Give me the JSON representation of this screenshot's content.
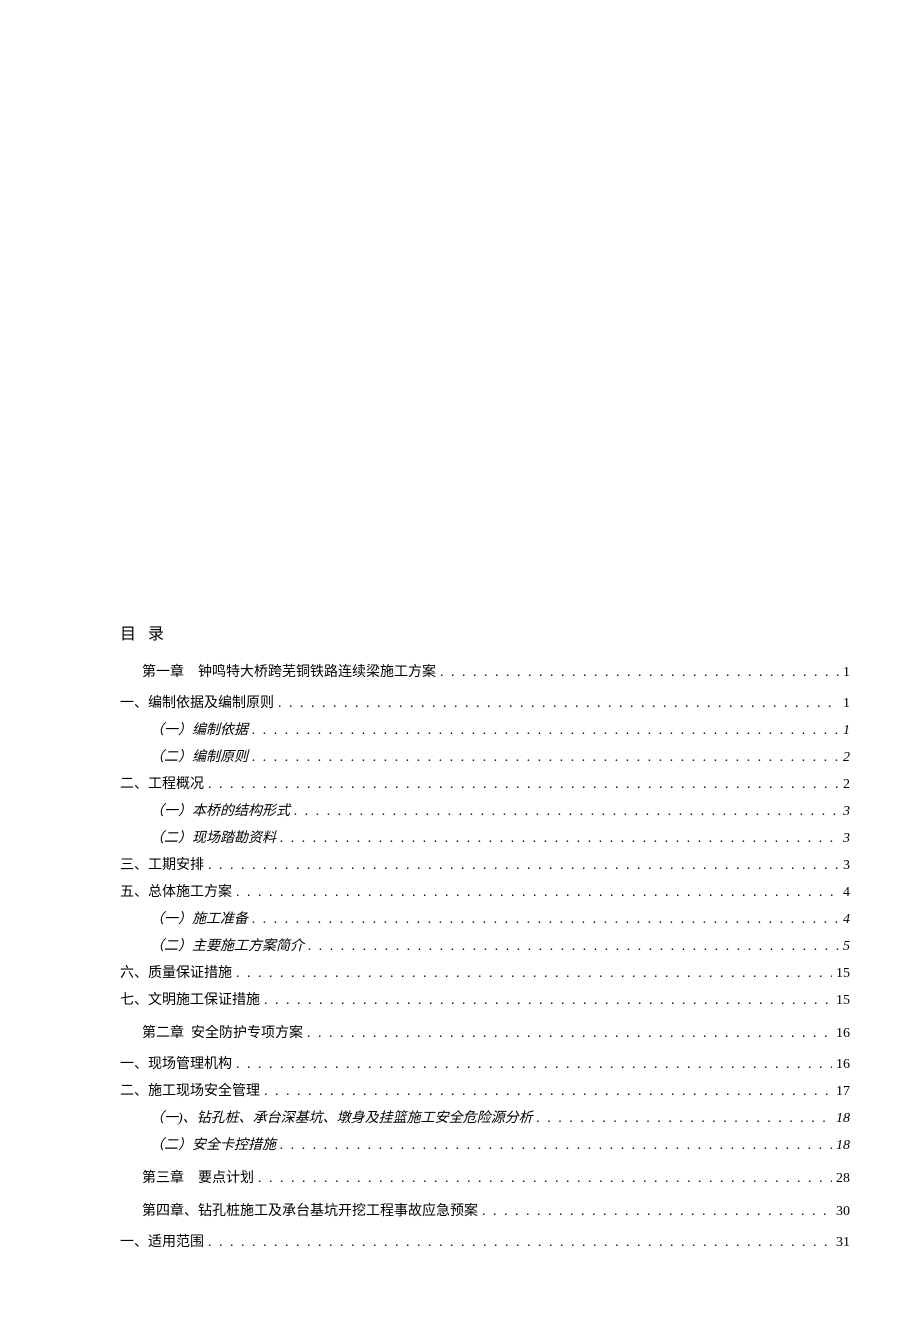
{
  "toc_title": "目 录",
  "dots": ". . . . . . . . . . . . . . . . . . . . . . . . . . . . . . . . . . . . . . . . . . . . . . . . . . . . . . . . . . . . . . . . . . . . . . . . . . . . . . . . . . . . . . . . . . . . . . . . . . . . . . . . . . . . . . . . . . . . . . . . . . . . . . . . . . . . . . . . . . . . . . . . . . . . . . . . . . . . . . . . . . . . . . . . . . . .",
  "entries": [
    {
      "level": "chapter",
      "text": "第一章 钟鸣特大桥跨芜铜铁路连续梁施工方案",
      "page": "1",
      "gap_before": false
    },
    {
      "level": "1",
      "text": "一、编制依据及编制原则",
      "page": "1",
      "gap_before": true
    },
    {
      "level": "2",
      "text": "（一）编制依据",
      "page": "1",
      "gap_before": false
    },
    {
      "level": "2",
      "text": "（二）编制原则",
      "page": "2",
      "gap_before": false
    },
    {
      "level": "1",
      "text": "二、工程概况",
      "page": "2",
      "gap_before": false
    },
    {
      "level": "2",
      "text": "（一）本桥的结构形式",
      "page": "3",
      "gap_before": false
    },
    {
      "level": "2",
      "text": "（二）现场踏勘资料",
      "page": "3",
      "gap_before": false
    },
    {
      "level": "1",
      "text": "三、工期安排",
      "page": "3",
      "gap_before": false
    },
    {
      "level": "1",
      "text": "五、总体施工方案",
      "page": "4",
      "gap_before": false
    },
    {
      "level": "2",
      "text": "（一）施工准备",
      "page": "4",
      "gap_before": false
    },
    {
      "level": "2",
      "text": "（二）主要施工方案简介",
      "page": "5",
      "gap_before": false
    },
    {
      "level": "1",
      "text": "六、质量保证措施",
      "page": "15",
      "gap_before": false
    },
    {
      "level": "1",
      "text": "七、文明施工保证措施",
      "page": "15",
      "gap_before": false
    },
    {
      "level": "chapter",
      "text": "第二章 安全防护专项方案",
      "page": "16",
      "gap_before": false
    },
    {
      "level": "1",
      "text": "一、现场管理机构",
      "page": "16",
      "gap_before": true
    },
    {
      "level": "1",
      "text": "二、施工现场安全管理",
      "page": "17",
      "gap_before": false
    },
    {
      "level": "2",
      "text": "（一)、钻孔桩、承台深基坑、墩身及挂篮施工安全危险源分析",
      "page": "18",
      "gap_before": false
    },
    {
      "level": "2",
      "text": "（二）安全卡控措施",
      "page": "18",
      "gap_before": false
    },
    {
      "level": "chapter",
      "text": "第三章 要点计划",
      "page": "28",
      "gap_before": false
    },
    {
      "level": "chapter",
      "text": "第四章、钻孔桩施工及承台基坑开挖工程事故应急预案",
      "page": "30",
      "gap_before": false
    },
    {
      "level": "1",
      "text": "一、适用范围",
      "page": "31",
      "gap_before": true
    }
  ]
}
